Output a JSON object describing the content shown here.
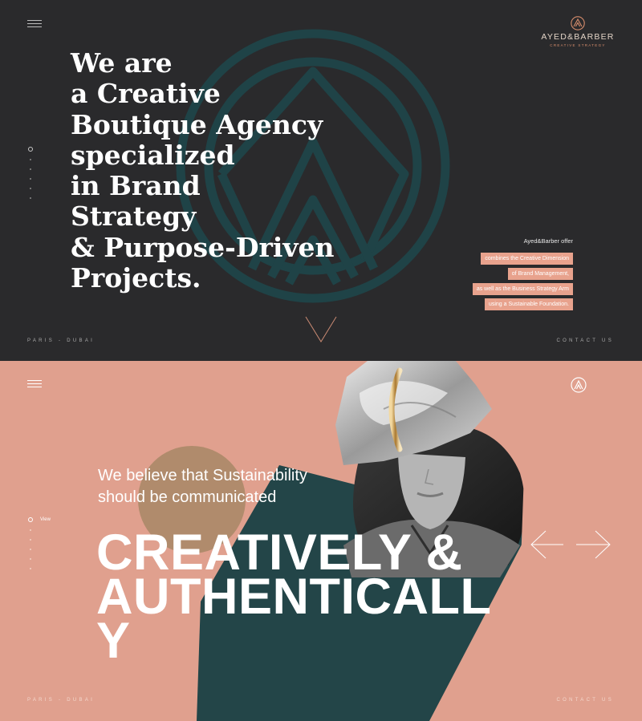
{
  "hero_dark": {
    "menu_icon": "hamburger-menu-icon",
    "logo": {
      "mark_icon": "ab-monogram-icon",
      "wordmark": "AYED&BARBER",
      "tagline": "CREATIVE STRATEGY"
    },
    "headline_lines": [
      "We are",
      "a Creative",
      "Boutique Agency",
      "specialized",
      "in Brand",
      "Strategy",
      "& Purpose-Driven",
      "Projects."
    ],
    "offer": {
      "intro": "Ayed&Barber offer",
      "lines": [
        "combines the Creative Dimension",
        "of Brand Management,",
        "as well as the Business Strategy Arm",
        "using a Sustainable Foundation."
      ]
    },
    "footer_left": "PARIS - DUBAI",
    "footer_right": "CONTACT US",
    "scroll_icon": "chevron-down-icon"
  },
  "hero_pink": {
    "menu_icon": "hamburger-menu-icon",
    "logo_icon": "ab-monogram-icon",
    "subheadline_lines": [
      "We believe that Sustainability",
      "should be communicated"
    ],
    "headline_lines": [
      "CREATIVELY &",
      "AUTHENTICALL",
      "Y"
    ],
    "view_label": "View",
    "prev_icon": "arrow-left-icon",
    "next_icon": "arrow-right-icon",
    "footer_left": "PARIS - DUBAI",
    "footer_right": "CONTACT US"
  },
  "colors": {
    "dark_bg": "#2a2a2c",
    "teal": "#1f4347",
    "pink_bg": "#e0a08e",
    "highlight": "#e8a28d",
    "gold_circle": "#b08b6c"
  }
}
